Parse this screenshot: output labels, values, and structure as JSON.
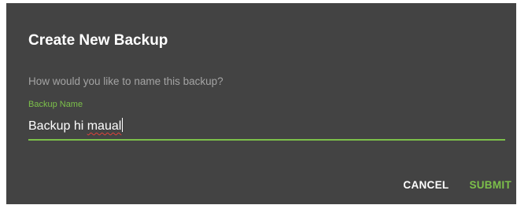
{
  "dialog": {
    "title": "Create New Backup",
    "prompt": "How would you like to name this backup?",
    "field": {
      "label": "Backup Name",
      "value_part1": "Backup hi ",
      "value_part2": "maual"
    },
    "actions": {
      "cancel_label": "CANCEL",
      "submit_label": "SUBMIT"
    }
  },
  "colors": {
    "dialog_background": "#434343",
    "accent": "#7cc04a",
    "spellcheck_underline": "#e0413a"
  }
}
